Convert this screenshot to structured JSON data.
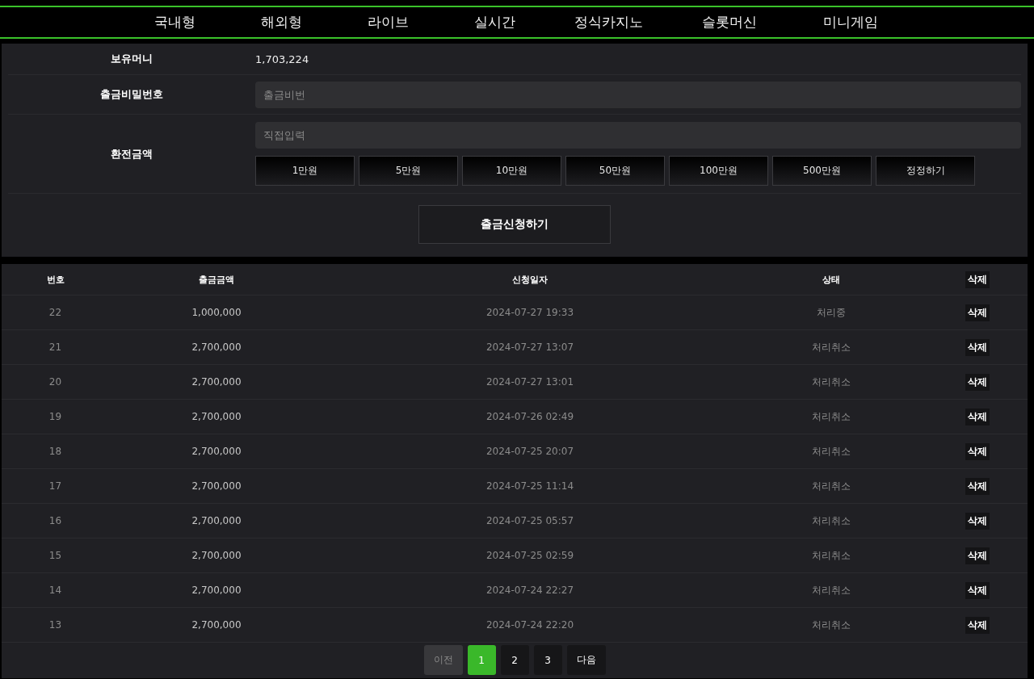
{
  "nav": {
    "items": [
      "국내형",
      "해외형",
      "라이브",
      "실시간",
      "정식카지노",
      "슬롯머신",
      "미니게임"
    ]
  },
  "form": {
    "balance_label": "보유머니",
    "balance": "1,703,224",
    "password_label": "출금비밀번호",
    "password": {
      "placeholder": "출금비번"
    },
    "amount_label": "환전금액",
    "amount": {
      "placeholder": "직접입력"
    },
    "amount_buttons": [
      "1만원",
      "5만원",
      "10만원",
      "50만원",
      "100만원",
      "500만원",
      "정정하기"
    ],
    "submit": "출금신청하기"
  },
  "table": {
    "columns": [
      "번호",
      "출금금액",
      "신청일자",
      "상태",
      "삭제"
    ],
    "rows": [
      {
        "no": "22",
        "amount": "1,000,000",
        "date": "2024-07-27 19:33",
        "status": "처리중",
        "action": "삭제"
      },
      {
        "no": "21",
        "amount": "2,700,000",
        "date": "2024-07-27 13:07",
        "status": "처리취소",
        "action": "삭제"
      },
      {
        "no": "20",
        "amount": "2,700,000",
        "date": "2024-07-27 13:01",
        "status": "처리취소",
        "action": "삭제"
      },
      {
        "no": "19",
        "amount": "2,700,000",
        "date": "2024-07-26 02:49",
        "status": "처리취소",
        "action": "삭제"
      },
      {
        "no": "18",
        "amount": "2,700,000",
        "date": "2024-07-25 20:07",
        "status": "처리취소",
        "action": "삭제"
      },
      {
        "no": "17",
        "amount": "2,700,000",
        "date": "2024-07-25 11:14",
        "status": "처리취소",
        "action": "삭제"
      },
      {
        "no": "16",
        "amount": "2,700,000",
        "date": "2024-07-25 05:57",
        "status": "처리취소",
        "action": "삭제"
      },
      {
        "no": "15",
        "amount": "2,700,000",
        "date": "2024-07-25 02:59",
        "status": "처리취소",
        "action": "삭제"
      },
      {
        "no": "14",
        "amount": "2,700,000",
        "date": "2024-07-24 22:27",
        "status": "처리취소",
        "action": "삭제"
      },
      {
        "no": "13",
        "amount": "2,700,000",
        "date": "2024-07-24 22:20",
        "status": "처리취소",
        "action": "삭제"
      }
    ]
  },
  "pagination": [
    {
      "label": "이전",
      "selected": false,
      "disabled": true
    },
    {
      "label": "1",
      "selected": true,
      "disabled": false
    },
    {
      "label": "2",
      "selected": false,
      "disabled": false
    },
    {
      "label": "3",
      "selected": false,
      "disabled": false
    },
    {
      "label": "다음",
      "selected": false,
      "disabled": false
    }
  ]
}
